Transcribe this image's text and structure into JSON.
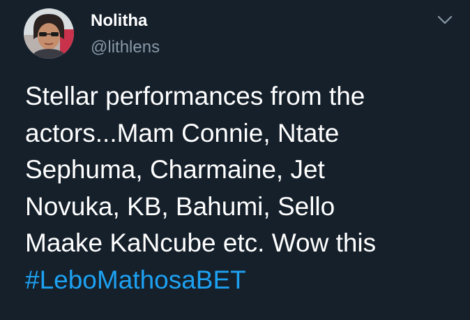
{
  "author": {
    "display_name": "Nolitha",
    "handle": "@lithlens"
  },
  "menu": {
    "icon": "chevron-down-icon"
  },
  "tweet": {
    "lines": [
      "Stellar performances from the",
      "actors...Mam Connie, Ntate",
      "Sephuma, Charmaine, Jet",
      "Novuka, KB, Bahumi, Sello",
      "Maake KaNcube etc. Wow this"
    ],
    "hashtag": "#LeboMathosaBET"
  },
  "colors": {
    "background": "#15202b",
    "text": "#ffffff",
    "secondary_text": "#8899a6",
    "link": "#1da1f2"
  }
}
